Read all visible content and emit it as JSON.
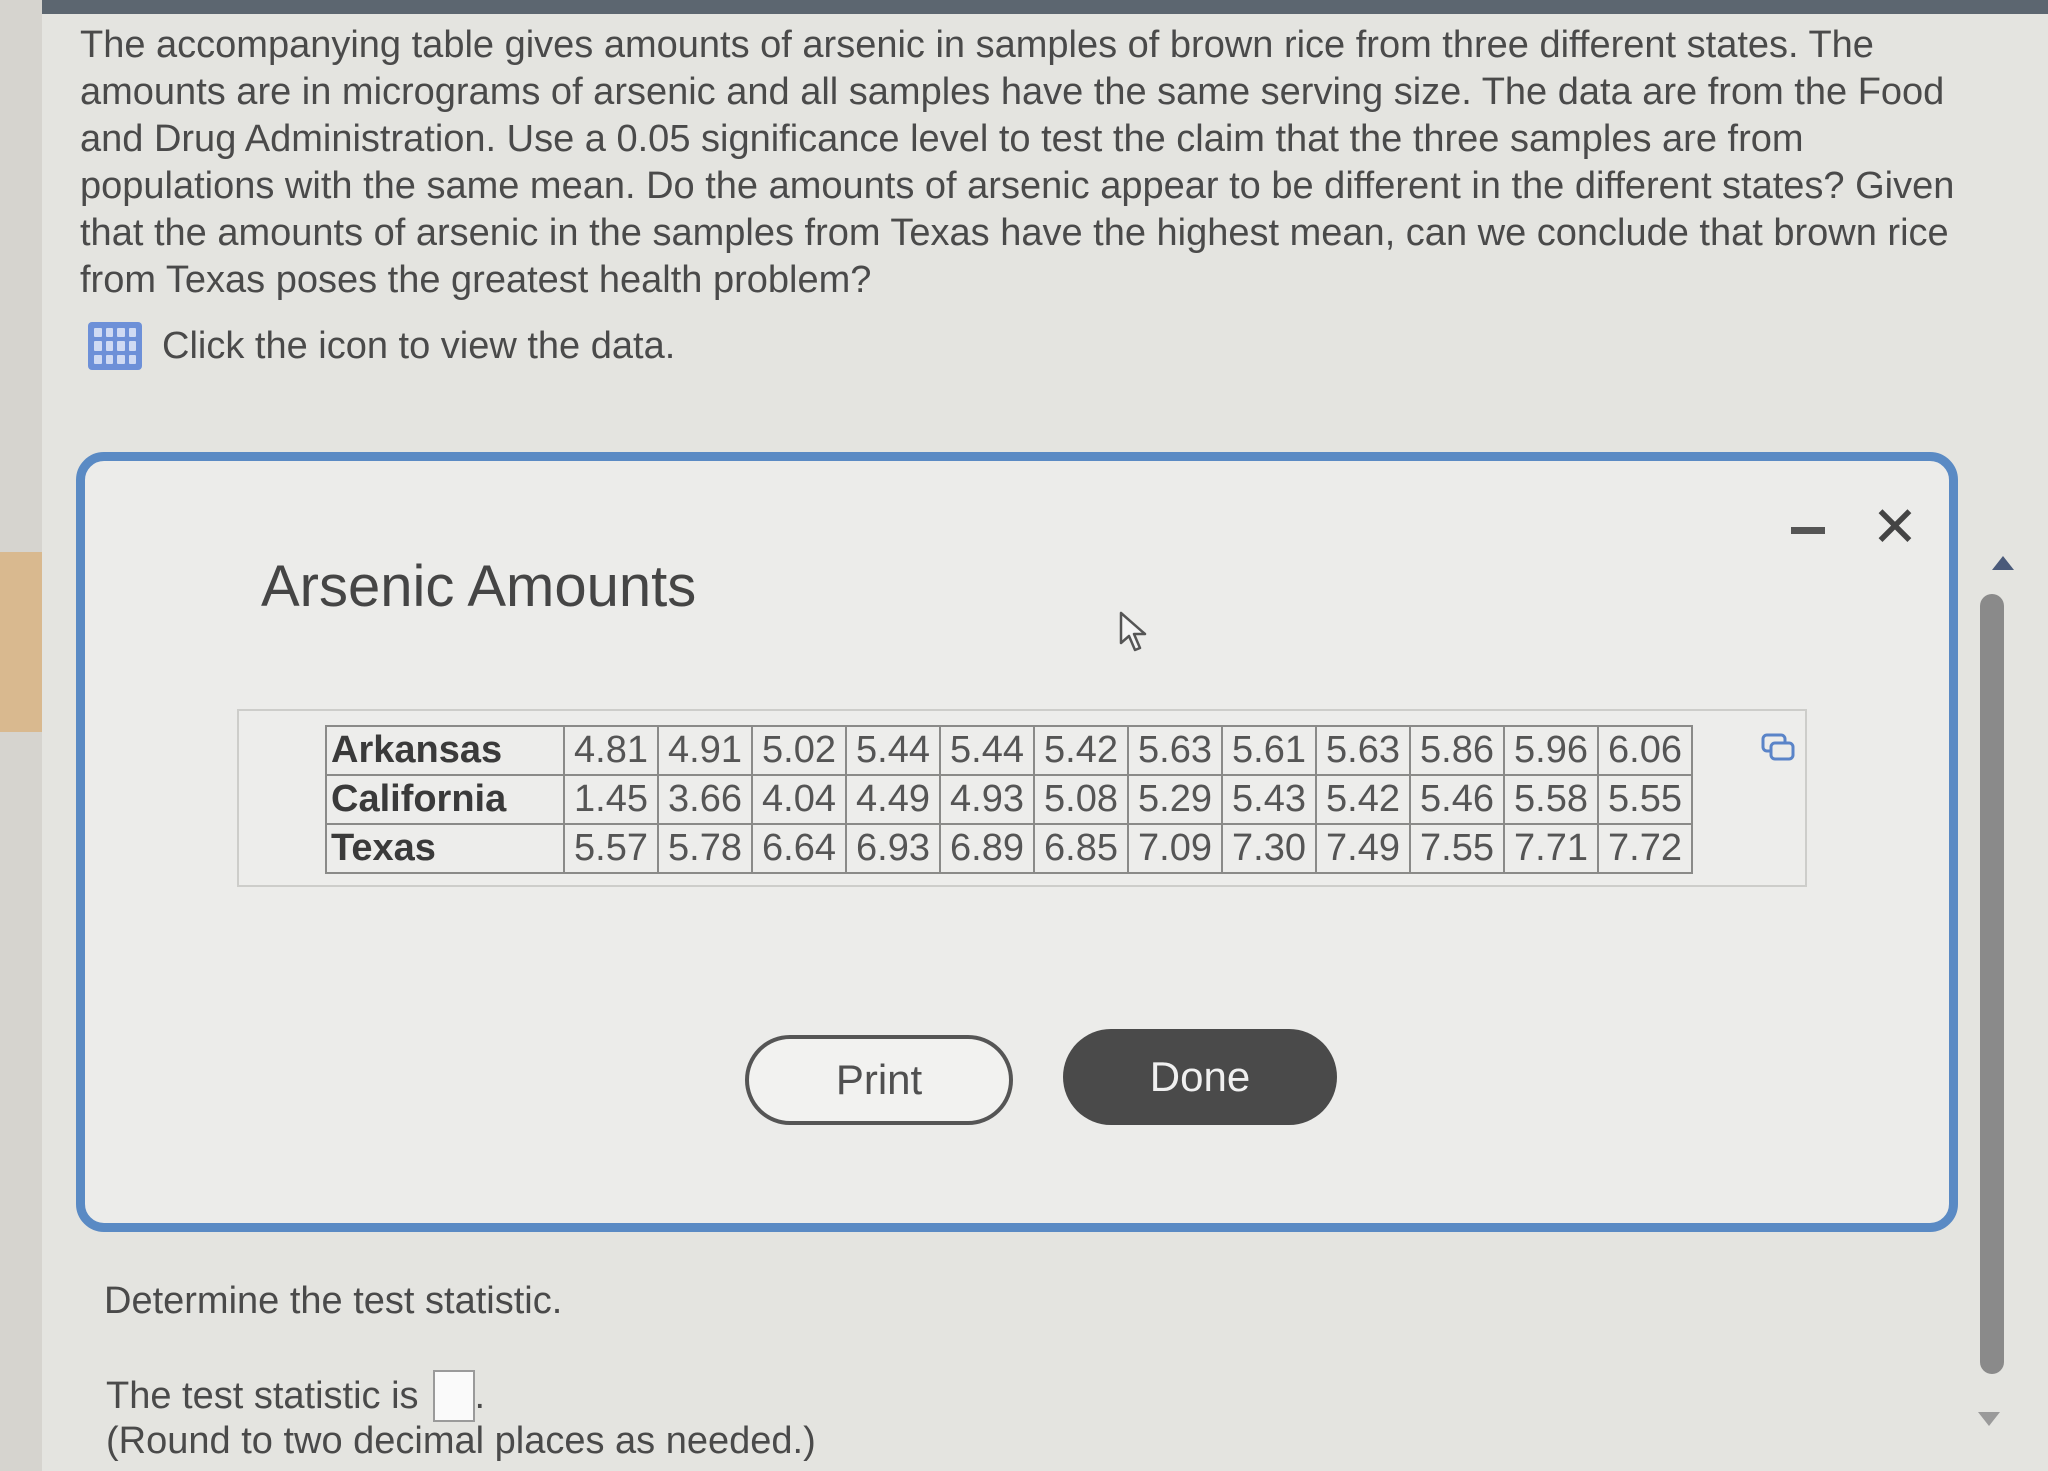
{
  "question": {
    "text": "The accompanying table gives amounts of arsenic in samples of brown rice from three different states. The amounts are in micrograms of arsenic and all samples have the same serving size. The data are from the Food and Drug Administration. Use a 0.05 significance level to test the claim that the three samples are from populations with the same mean. Do the amounts of arsenic appear to be different in the different states? Given that the amounts of arsenic in the samples from Texas have the highest mean, can we conclude that brown rice from Texas poses the greatest health problem?",
    "data_link": "Click the icon to view the data."
  },
  "modal": {
    "title": "Arsenic Amounts",
    "rows": [
      {
        "state": "Arkansas",
        "values": [
          "4.81",
          "4.91",
          "5.02",
          "5.44",
          "5.44",
          "5.42",
          "5.63",
          "5.61",
          "5.63",
          "5.86",
          "5.96",
          "6.06"
        ]
      },
      {
        "state": "California",
        "values": [
          "1.45",
          "3.66",
          "4.04",
          "4.49",
          "4.93",
          "5.08",
          "5.29",
          "5.43",
          "5.42",
          "5.46",
          "5.58",
          "5.55"
        ]
      },
      {
        "state": "Texas",
        "values": [
          "5.57",
          "5.78",
          "6.64",
          "6.93",
          "6.89",
          "6.85",
          "7.09",
          "7.30",
          "7.49",
          "7.55",
          "7.71",
          "7.72"
        ]
      }
    ],
    "print_label": "Print",
    "done_label": "Done",
    "close_glyph": "✕"
  },
  "prompt": {
    "instruction": "Determine the test statistic.",
    "stat_label": "The test statistic is",
    "stat_suffix": ".",
    "round_note": "(Round to two decimal places as needed.)"
  },
  "colors": {
    "modal_border": "#5a8ac4",
    "done_button": "#4a4a4a",
    "icon_blue": "#6d90d8"
  }
}
